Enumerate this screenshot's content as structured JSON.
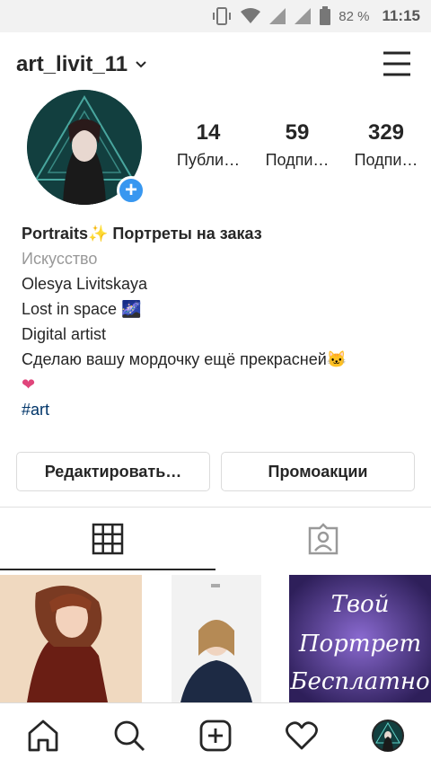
{
  "status_bar": {
    "battery": "82 %",
    "time": "11:15"
  },
  "header": {
    "username": "art_livit_11"
  },
  "stats": [
    {
      "value": "14",
      "label": "Публи…"
    },
    {
      "value": "59",
      "label": "Подпи…"
    },
    {
      "value": "329",
      "label": "Подпи…"
    }
  ],
  "bio": {
    "name": "Portraits✨ Портреты на заказ",
    "category": "Искусство",
    "lines": [
      "Olesya Livitskaya",
      "Lost in space 🌌",
      "Digital artist",
      "Сделаю вашу мордочку ещё прекрасней🐱",
      "❤"
    ],
    "hashtag": "#art"
  },
  "buttons": {
    "edit": "Редактировать…",
    "promo": "Промоакции"
  },
  "grid": [
    {
      "kind": "portrait-red"
    },
    {
      "kind": "portrait-pilot"
    },
    {
      "kind": "promo",
      "text_lines": [
        "Твой",
        "Портрет",
        "Бесплатно"
      ]
    }
  ],
  "colors": {
    "accent": "#3897f0",
    "hashtag": "#003569",
    "text": "#262626",
    "muted": "#999999"
  }
}
